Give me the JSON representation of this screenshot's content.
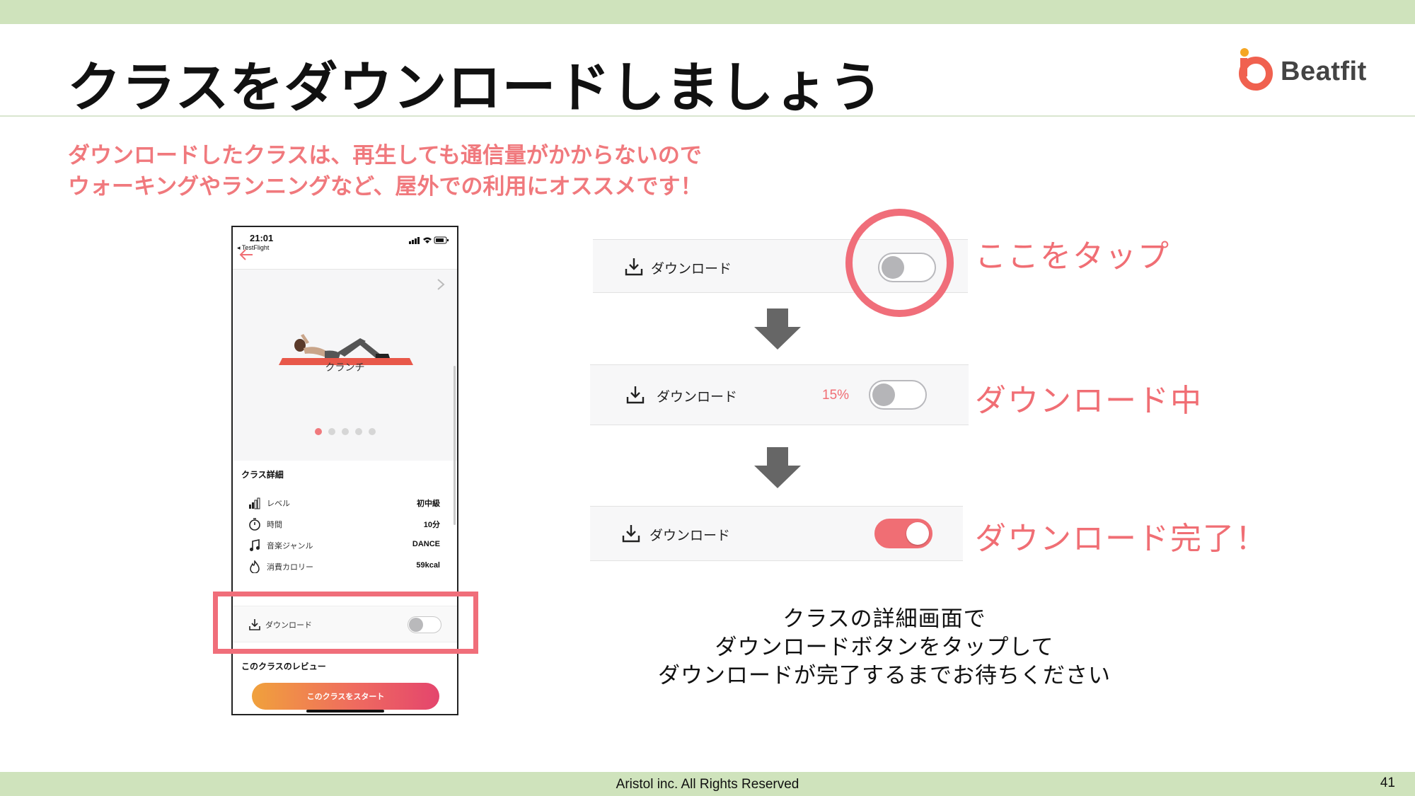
{
  "slide": {
    "title": "クラスをダウンロードしましょう",
    "subtitle_line1": "ダウンロードしたクラスは、再生しても通信量がかからないので",
    "subtitle_line2": "ウォーキングやランニングなど、屋外での利用にオススメです！",
    "footer": "Aristol inc. All Rights Reserved",
    "page_number": "41"
  },
  "logo": {
    "text": "Beatfit",
    "accent_color": "#f0614f"
  },
  "phone": {
    "status_time": "21:01",
    "back_app": "◂ TestFlight",
    "exercise_name": "クランチ",
    "carousel": {
      "count": 5,
      "active_index": 0
    },
    "details_title": "クラス詳細",
    "details": [
      {
        "icon": "level-bars-icon",
        "label": "レベル",
        "value": "初中級"
      },
      {
        "icon": "timer-icon",
        "label": "時間",
        "value": "10分"
      },
      {
        "icon": "music-note-icon",
        "label": "音楽ジャンル",
        "value": "DANCE"
      },
      {
        "icon": "flame-icon",
        "label": "消費カロリー",
        "value": "59kcal"
      }
    ],
    "download_label": "ダウンロード",
    "download_toggle_on": false,
    "review_title": "このクラスのレビュー",
    "start_button": "このクラスをスタート"
  },
  "steps": [
    {
      "label": "ダウンロード",
      "percent": "",
      "toggle_on": false,
      "caption": "ここをタップ"
    },
    {
      "label": "ダウンロード",
      "percent": "15%",
      "toggle_on": false,
      "caption": "ダウンロード中"
    },
    {
      "label": "ダウンロード",
      "percent": "",
      "toggle_on": true,
      "caption": "ダウンロード完了！"
    }
  ],
  "instructions": {
    "line1": "クラスの詳細画面で",
    "line2": "ダウンロードボタンをタップして",
    "line3": "ダウンロードが完了するまでお待ちください"
  },
  "colors": {
    "accent_pink": "#f06e74",
    "band_green": "#cfe3bc",
    "subtitle_pink": "#f0797d"
  }
}
